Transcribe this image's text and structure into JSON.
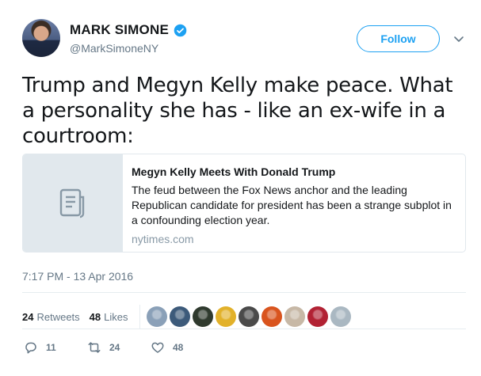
{
  "author": {
    "display_name": "MARK SIMONE",
    "handle": "@MarkSimoneNY",
    "verified": true
  },
  "follow_button": {
    "label": "Follow"
  },
  "tweet": {
    "text": "Trump and Megyn Kelly make peace. What a personality she has - like an ex-wife in a courtroom:"
  },
  "card": {
    "title": "Megyn Kelly Meets With Donald Trump",
    "description": "The feud between the Fox News anchor and the leading Republican candidate for president has been a strange subplot in a confounding election year.",
    "domain": "nytimes.com",
    "thumbnail_icon": "document-icon"
  },
  "timestamp": "7:17 PM - 13 Apr 2016",
  "stats": {
    "retweets_count": "24",
    "retweets_label": "Retweets",
    "likes_count": "48",
    "likes_label": "Likes"
  },
  "liker_avatars": [
    "#8aa0b8",
    "#3c5a7a",
    "#2f3a2e",
    "#e2b12a",
    "#4a4a4a",
    "#d9541e",
    "#c7b8a6",
    "#b22234",
    "#aab8c2"
  ],
  "actions": {
    "reply_count": "11",
    "retweet_count": "24",
    "like_count": "48"
  },
  "colors": {
    "accent": "#1da1f2",
    "text": "#14171a",
    "muted": "#657786",
    "border": "#e1e8ed"
  }
}
